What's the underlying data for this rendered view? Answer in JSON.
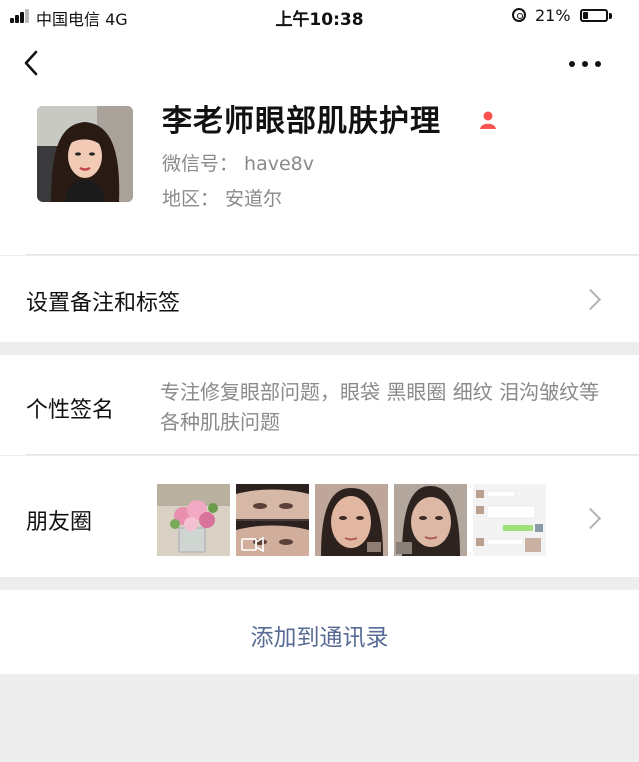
{
  "status_bar": {
    "carrier": "中国电信   4G",
    "time": "上午10:38",
    "battery": "21%",
    "battery_level": 0.21
  },
  "nav": {
    "back_icon": "chevron-left-icon",
    "more_icon": "more-dots-icon"
  },
  "profile": {
    "name": "李老师眼部肌肤护理",
    "wechat_id": "微信号：  have8v",
    "region": "地区：  安道尔",
    "gender_icon": "female-icon",
    "gender_color": "#fa5151"
  },
  "rows": {
    "remark_label": "设置备注和标签",
    "signature_label": "个性签名",
    "signature_text": "专注修复眼部问题，眼袋  黑眼圈  细纹  泪沟皱纹等各种肌肤问题",
    "moments_label": "朋友圈"
  },
  "actions": {
    "add_contact": "添加到通讯录"
  },
  "colors": {
    "link_blue": "#576b95",
    "background": "#ededed"
  }
}
